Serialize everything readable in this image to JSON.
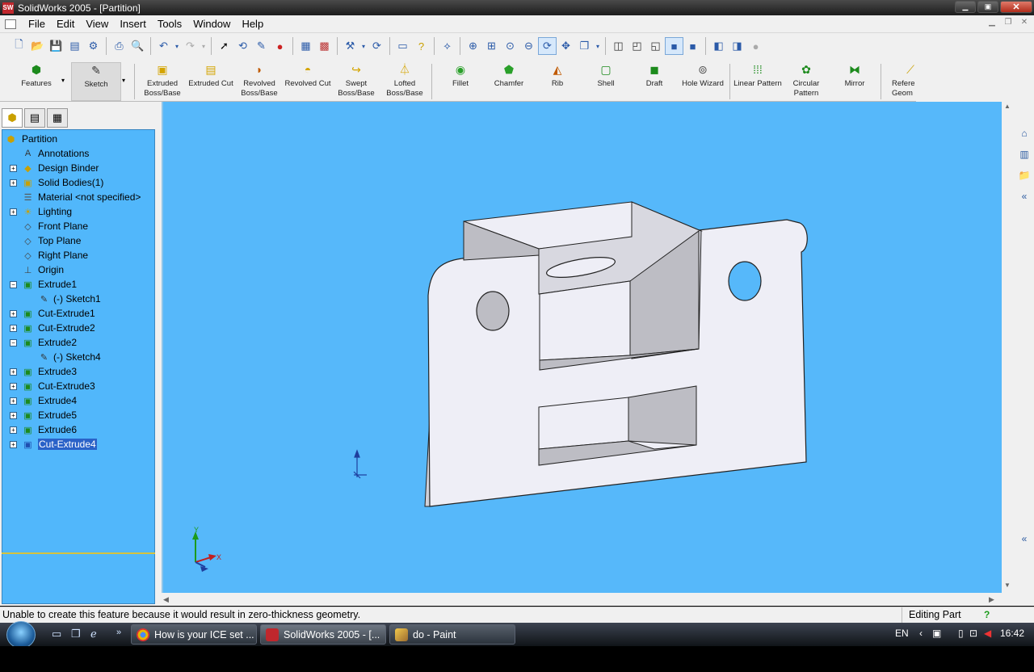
{
  "window": {
    "app_icon": "SW",
    "title": "SolidWorks 2005 - [Partition]"
  },
  "menu": [
    "File",
    "Edit",
    "View",
    "Insert",
    "Tools",
    "Window",
    "Help"
  ],
  "command_manager": {
    "groups": [
      {
        "label": "Features",
        "icon": "features-icon"
      },
      {
        "label": "Sketch",
        "icon": "sketch-icon"
      }
    ],
    "buttons": [
      {
        "label": "Extruded Boss/Base",
        "icon": "extruded-boss-icon"
      },
      {
        "label": "Extruded Cut",
        "icon": "extruded-cut-icon"
      },
      {
        "label": "Revolved Boss/Base",
        "icon": "revolved-boss-icon"
      },
      {
        "label": "Revolved Cut",
        "icon": "revolved-cut-icon"
      },
      {
        "label": "Swept Boss/Base",
        "icon": "swept-boss-icon"
      },
      {
        "label": "Lofted Boss/Base",
        "icon": "lofted-boss-icon"
      },
      {
        "label": "Fillet",
        "icon": "fillet-icon"
      },
      {
        "label": "Chamfer",
        "icon": "chamfer-icon"
      },
      {
        "label": "Rib",
        "icon": "rib-icon"
      },
      {
        "label": "Shell",
        "icon": "shell-icon"
      },
      {
        "label": "Draft",
        "icon": "draft-icon"
      },
      {
        "label": "Hole Wizard",
        "icon": "hole-wizard-icon"
      },
      {
        "label": "Linear Pattern",
        "icon": "linear-pattern-icon"
      },
      {
        "label": "Circular Pattern",
        "icon": "circular-pattern-icon"
      },
      {
        "label": "Mirror",
        "icon": "mirror-icon"
      },
      {
        "label": "Refere Geom",
        "icon": "reference-geometry-icon"
      }
    ]
  },
  "feature_tree": {
    "root": "Partition",
    "items": [
      {
        "label": "Annotations",
        "expander": ""
      },
      {
        "label": "Design Binder",
        "expander": "+"
      },
      {
        "label": "Solid Bodies(1)",
        "expander": "+"
      },
      {
        "label": "Material <not specified>",
        "expander": ""
      },
      {
        "label": "Lighting",
        "expander": "+"
      },
      {
        "label": "Front Plane",
        "expander": ""
      },
      {
        "label": "Top Plane",
        "expander": ""
      },
      {
        "label": "Right Plane",
        "expander": ""
      },
      {
        "label": "Origin",
        "expander": ""
      },
      {
        "label": "Extrude1",
        "expander": "−"
      },
      {
        "label": "(-) Sketch1",
        "expander": ""
      },
      {
        "label": "Cut-Extrude1",
        "expander": "+"
      },
      {
        "label": "Cut-Extrude2",
        "expander": "+"
      },
      {
        "label": "Extrude2",
        "expander": "−"
      },
      {
        "label": "(-) Sketch4",
        "expander": ""
      },
      {
        "label": "Extrude3",
        "expander": "+"
      },
      {
        "label": "Cut-Extrude3",
        "expander": "+"
      },
      {
        "label": "Extrude4",
        "expander": "+"
      },
      {
        "label": "Extrude5",
        "expander": "+"
      },
      {
        "label": "Extrude6",
        "expander": "+"
      },
      {
        "label": "Cut-Extrude4",
        "expander": "+",
        "selected": true
      }
    ]
  },
  "viewport": {
    "background": "#56b8fa",
    "part_face": "#eeeef6",
    "part_shade": "#bdbdc4",
    "triad_y": "Y",
    "triad_x": "X"
  },
  "status": {
    "message": "Unable to create this feature because it would result in zero-thickness geometry.",
    "mode": "Editing Part",
    "help": "?"
  },
  "taskbar": {
    "tasks": [
      {
        "label": "How is your ICE set ...",
        "icon": "chrome-icon"
      },
      {
        "label": "SolidWorks 2005 - [...",
        "icon": "solidworks-icon"
      },
      {
        "label": "do - Paint",
        "icon": "paint-icon"
      }
    ],
    "lang": "EN",
    "clock": "16:42"
  }
}
